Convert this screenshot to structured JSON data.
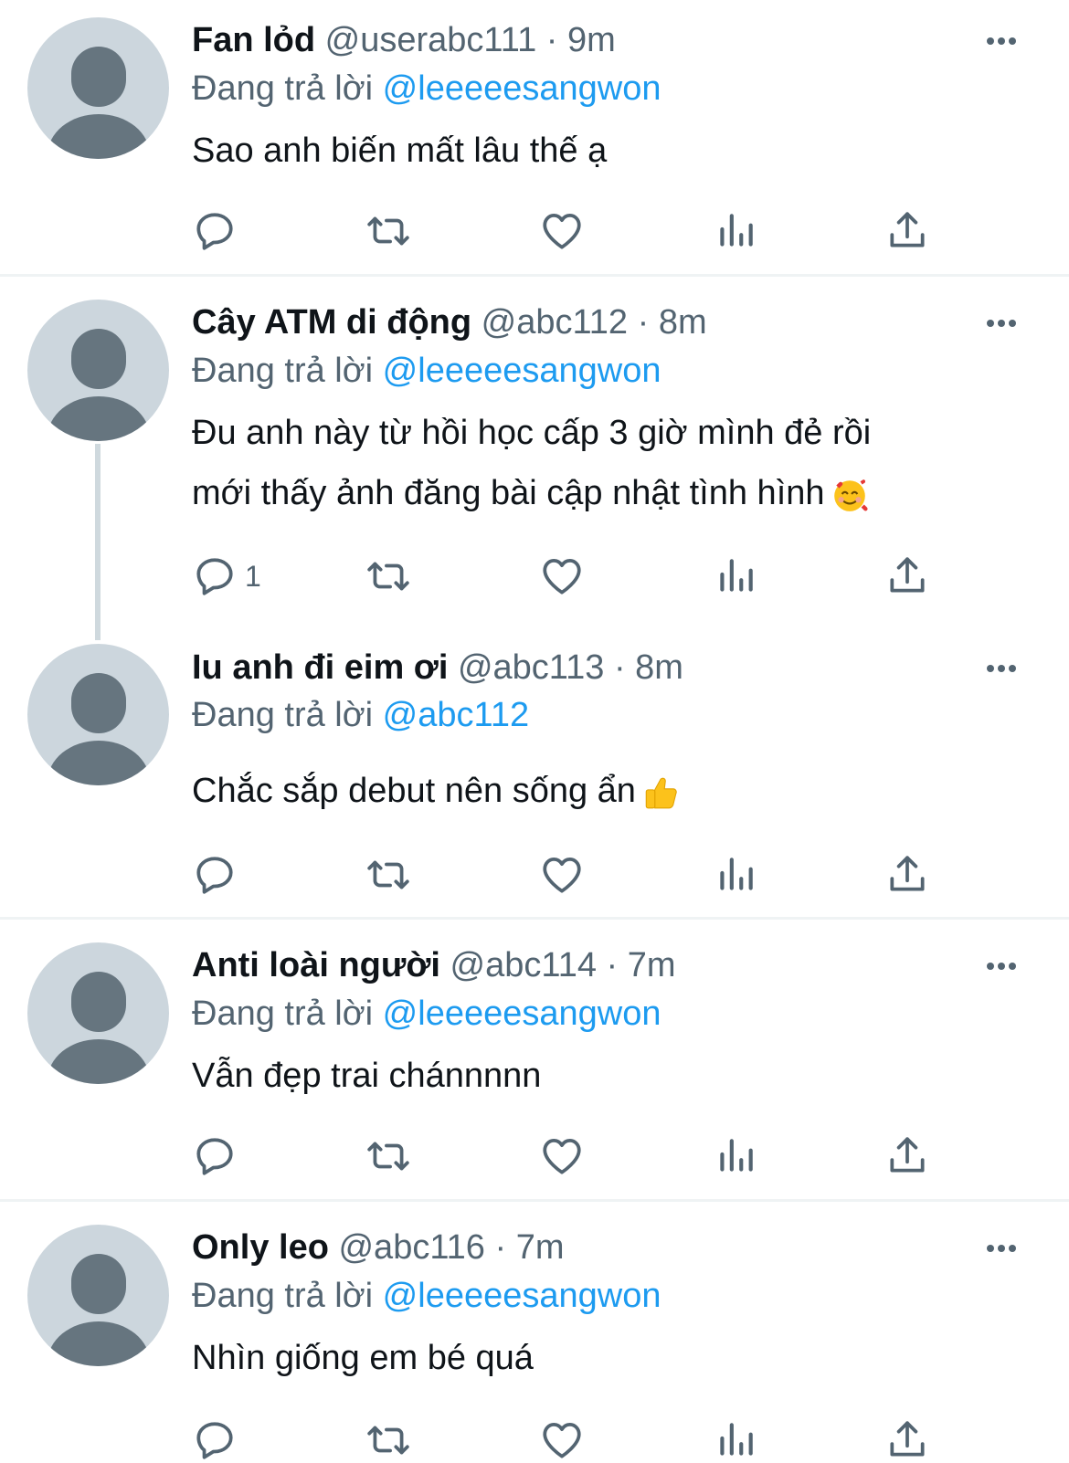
{
  "tweets": [
    {
      "name": "Fan lỏd",
      "handle": "@userabc111",
      "time": "9m",
      "replying_label": "Đang trả lời",
      "replying_to": "@leeeeesangwon",
      "text": "Sao anh biến mất lâu thế ạ",
      "reply_count": ""
    },
    {
      "name": "Cây ATM di động",
      "handle": "@abc112",
      "time": "8m",
      "replying_label": "Đang trả lời",
      "replying_to": "@leeeeesangwon",
      "text_line1": "Đu anh này từ hồi học cấp 3 giờ mình đẻ rồi",
      "text_line2": "mới thấy ảnh đăng bài cập nhật tình hình",
      "emoji": "smiling-face-with-hearts",
      "reply_count": "1"
    },
    {
      "name": "Iu anh đi eim ơi",
      "handle": "@abc113",
      "time": "8m",
      "replying_label": "Đang trả lời",
      "replying_to": "@abc112",
      "text": "Chắc sắp debut nên sống ẩn",
      "emoji": "thumbs-up",
      "reply_count": ""
    },
    {
      "name": "Anti loài người",
      "handle": "@abc114",
      "time": "7m",
      "replying_label": "Đang trả lời",
      "replying_to": "@leeeeesangwon",
      "text": "Vẫn đẹp trai chánnnnn",
      "reply_count": ""
    },
    {
      "name": "Only leo",
      "handle": "@abc116",
      "time": "7m",
      "replying_label": "Đang trả lời",
      "replying_to": "@leeeeesangwon",
      "text": "Nhìn giống em bé quá",
      "reply_count": ""
    }
  ],
  "separator": "·",
  "icons": {
    "reply": "reply-icon",
    "retweet": "retweet-icon",
    "like": "heart-icon",
    "views": "views-icon",
    "share": "share-icon",
    "more": "more-icon"
  },
  "colors": {
    "accent": "#1d9bf0",
    "secondary_text": "#536471",
    "avatar_bg": "#ccd6dd",
    "avatar_fg": "#66757f"
  }
}
